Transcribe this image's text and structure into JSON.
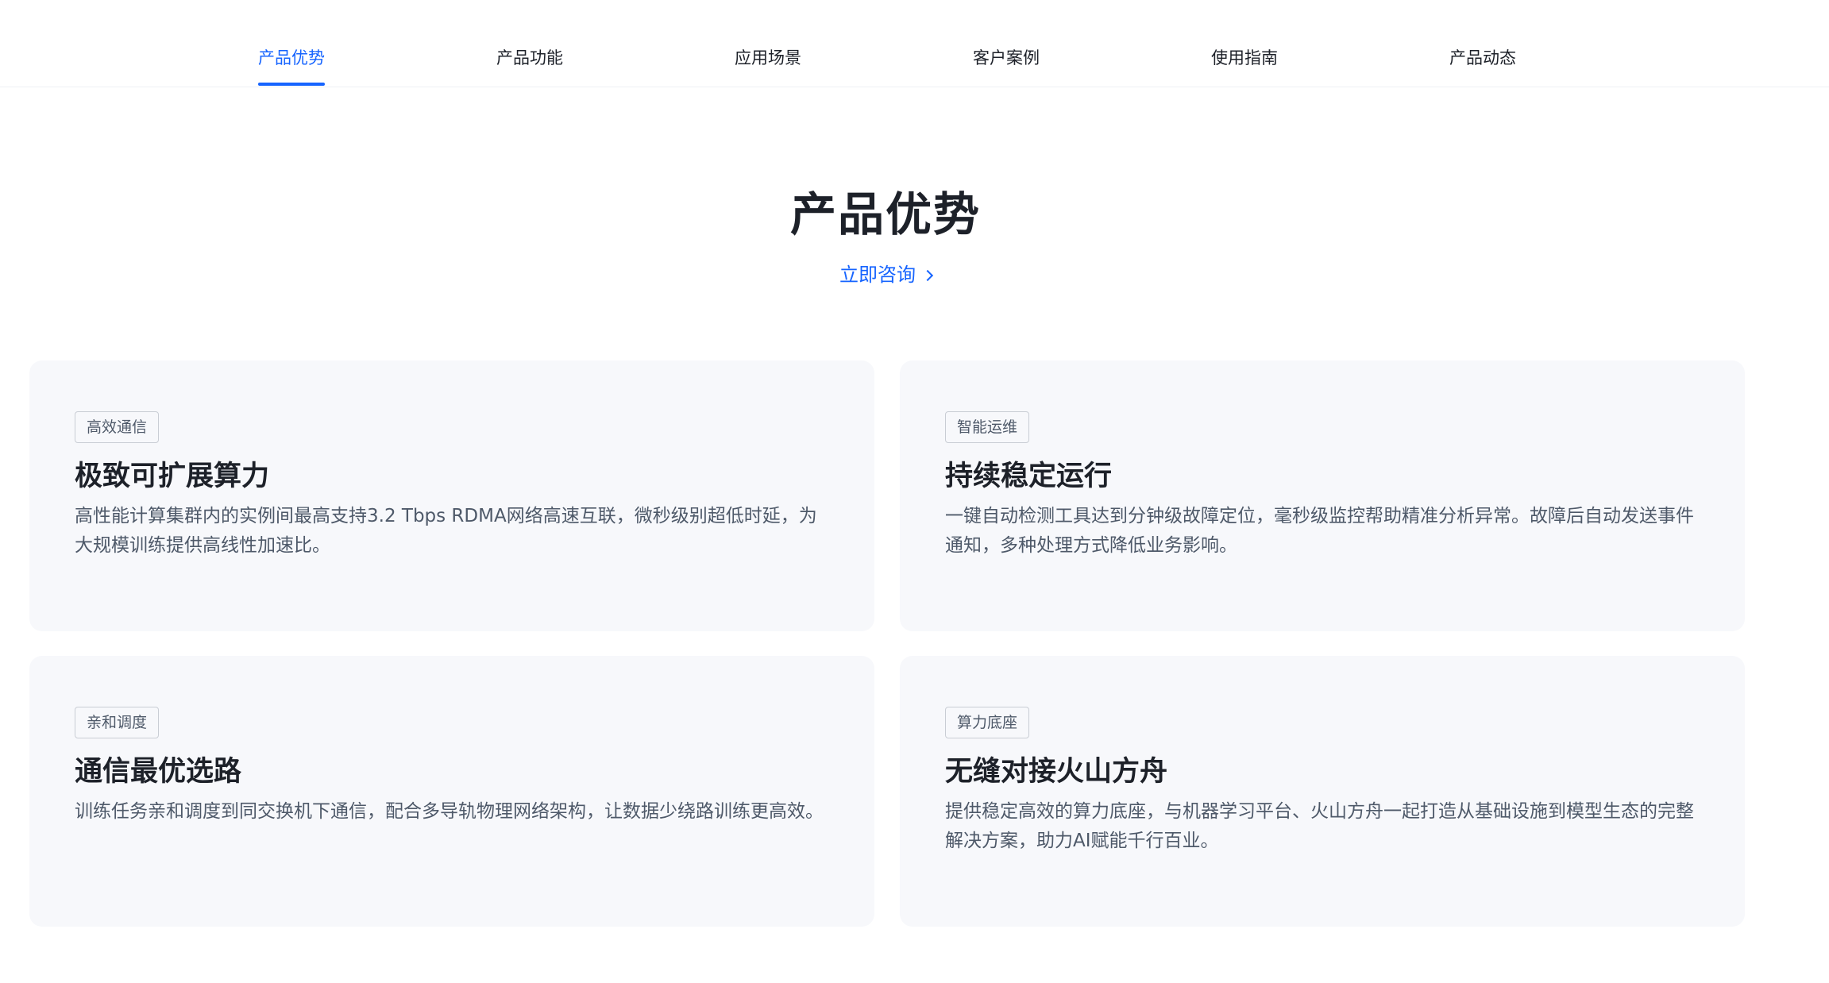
{
  "nav": {
    "items": [
      {
        "label": "产品优势",
        "active": true
      },
      {
        "label": "产品功能",
        "active": false
      },
      {
        "label": "应用场景",
        "active": false
      },
      {
        "label": "客户案例",
        "active": false
      },
      {
        "label": "使用指南",
        "active": false
      },
      {
        "label": "产品动态",
        "active": false
      }
    ]
  },
  "section": {
    "title": "产品优势",
    "consult_label": "立即咨询"
  },
  "cards": [
    {
      "tag": "高效通信",
      "title": "极致可扩展算力",
      "desc": "高性能计算集群内的实例间最高支持3.2 Tbps RDMA网络高速互联，微秒级别超低时延，为大规模训练提供高线性加速比。"
    },
    {
      "tag": "智能运维",
      "title": "持续稳定运行",
      "desc": "一键自动检测工具达到分钟级故障定位，毫秒级监控帮助精准分析异常。故障后自动发送事件通知，多种处理方式降低业务影响。"
    },
    {
      "tag": "亲和调度",
      "title": "通信最优选路",
      "desc": "训练任务亲和调度到同交换机下通信，配合多导轨物理网络架构，让数据少绕路训练更高效。"
    },
    {
      "tag": "算力底座",
      "title": "无缝对接火山方舟",
      "desc": "提供稳定高效的算力底座，与机器学习平台、火山方舟一起打造从基础设施到模型生态的完整解决方案，助力AI赋能千行百业。"
    }
  ],
  "colors": {
    "accent": "#1664ff",
    "card_bg": "#f7f8fb",
    "text_primary": "#1d2129",
    "text_secondary": "#4e5969"
  }
}
